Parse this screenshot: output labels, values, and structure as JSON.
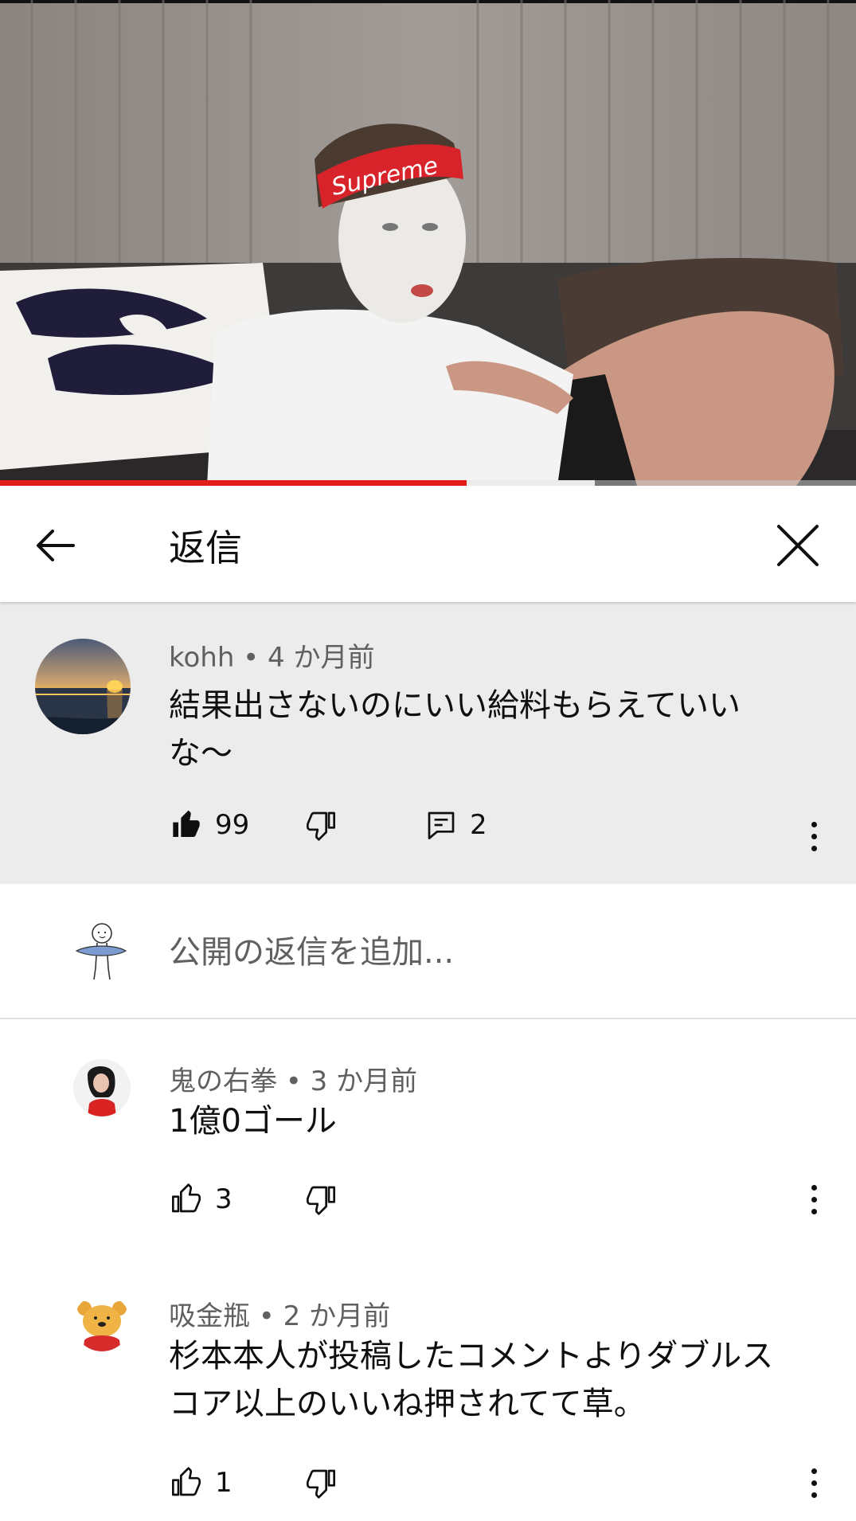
{
  "header": {
    "title": "返信"
  },
  "video": {
    "progress_played": 0.545,
    "progress_buffered": 0.695,
    "colors": {
      "played": "#e21b1b",
      "buffered": "#ebebeb"
    }
  },
  "parent_comment": {
    "author": "kohh",
    "time": "4 か月前",
    "meta": "kohh • 4 か月前",
    "text_line1": "結果出さないのにいい給料もらえていい",
    "text_line2": "な〜",
    "likes": "99",
    "replies": "2",
    "liked": true
  },
  "add_reply": {
    "placeholder": "公開の返信を追加..."
  },
  "replies": [
    {
      "meta": "鬼の右拳 • 3 か月前",
      "text_line1": "1億0ゴール",
      "likes": "3"
    },
    {
      "meta": "吸金瓶 • 2 か月前",
      "text_line1": "杉本本人が投稿したコメントよりダブルス",
      "text_line2": "コア以上のいいね押されてて草。",
      "likes": "1"
    }
  ],
  "icons": {
    "back": "arrow-left-icon",
    "close": "close-icon",
    "like": "thumbs-up-icon",
    "dislike": "thumbs-down-icon",
    "reply": "comment-icon",
    "more": "more-vertical-icon"
  }
}
